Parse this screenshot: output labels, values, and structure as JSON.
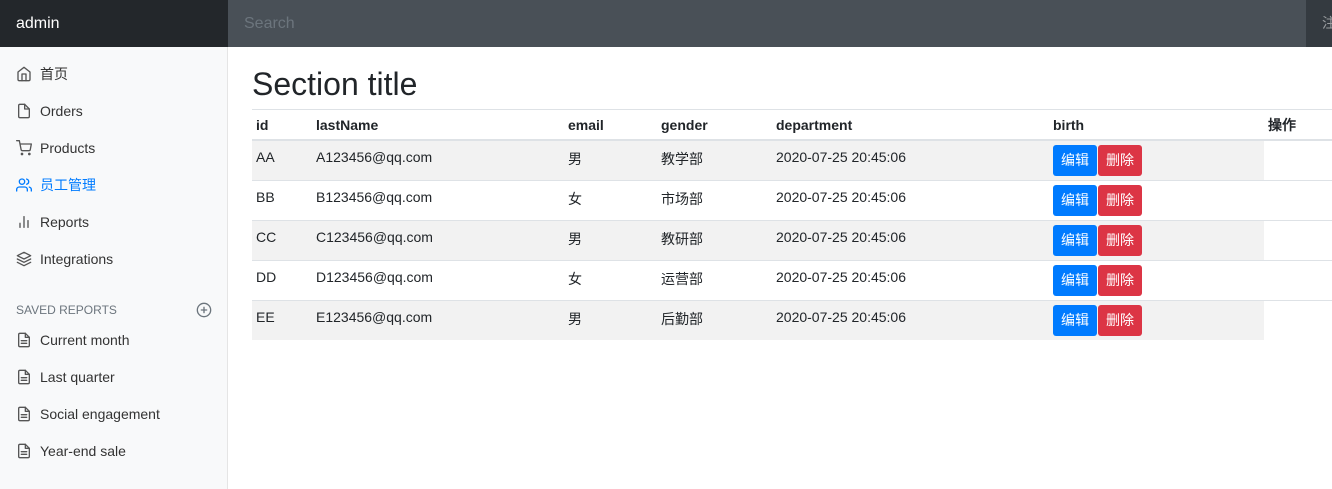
{
  "navbar": {
    "brand": "admin",
    "search_placeholder": "Search",
    "signout_label": "注"
  },
  "sidebar": {
    "items": [
      {
        "label": "首页",
        "icon": "home-icon"
      },
      {
        "label": "Orders",
        "icon": "file-icon"
      },
      {
        "label": "Products",
        "icon": "shopping-cart-icon"
      },
      {
        "label": "员工管理",
        "icon": "users-icon"
      },
      {
        "label": "Reports",
        "icon": "bar-chart-icon"
      },
      {
        "label": "Integrations",
        "icon": "layers-icon"
      }
    ],
    "saved_reports_heading": "SAVED REPORTS",
    "saved_reports": [
      {
        "label": "Current month",
        "icon": "file-text-icon"
      },
      {
        "label": "Last quarter",
        "icon": "file-text-icon"
      },
      {
        "label": "Social engagement",
        "icon": "file-text-icon"
      },
      {
        "label": "Year-end sale",
        "icon": "file-text-icon"
      }
    ]
  },
  "main": {
    "title": "Section title",
    "table": {
      "headers": [
        "id",
        "lastName",
        "email",
        "gender",
        "department",
        "birth",
        "操作"
      ],
      "rows": [
        {
          "id": "AA",
          "lastName": "A123456@qq.com",
          "email": "男",
          "gender": "教学部",
          "department": "2020-07-25 20:45:06"
        },
        {
          "id": "BB",
          "lastName": "B123456@qq.com",
          "email": "女",
          "gender": "市场部",
          "department": "2020-07-25 20:45:06"
        },
        {
          "id": "CC",
          "lastName": "C123456@qq.com",
          "email": "男",
          "gender": "教研部",
          "department": "2020-07-25 20:45:06"
        },
        {
          "id": "DD",
          "lastName": "D123456@qq.com",
          "email": "女",
          "gender": "运营部",
          "department": "2020-07-25 20:45:06"
        },
        {
          "id": "EE",
          "lastName": "E123456@qq.com",
          "email": "男",
          "gender": "后勤部",
          "department": "2020-07-25 20:45:06"
        }
      ],
      "edit_label": "编辑",
      "delete_label": "删除"
    }
  },
  "colors": {
    "active": "#007bff",
    "primary": "#007bff",
    "danger": "#dc3545",
    "navbar": "#343a40"
  }
}
